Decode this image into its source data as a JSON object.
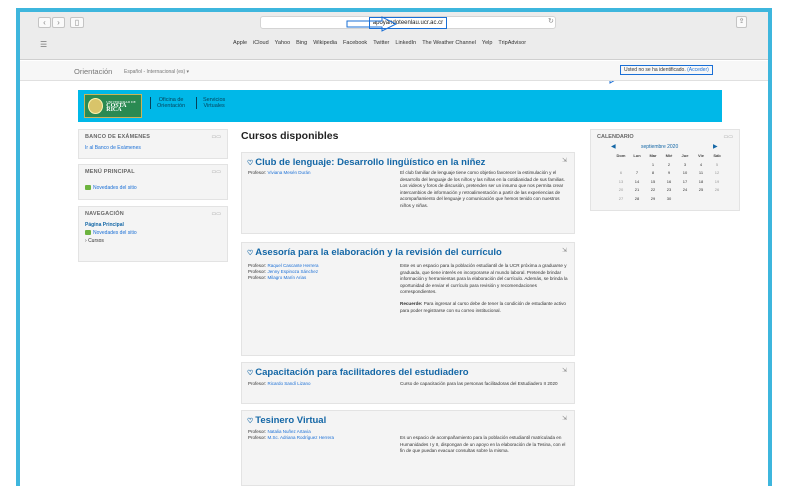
{
  "browser": {
    "url": "apoyandoteenlau.ucr.ac.cr",
    "bookmarks": [
      "Apple",
      "iCloud",
      "Yahoo",
      "Bing",
      "Wikipedia",
      "Facebook",
      "Twitter",
      "LinkedIn",
      "The Weather Channel",
      "Yelp",
      "TripAdvisor"
    ]
  },
  "header": {
    "site_name": "Orientación",
    "language": "Español - Internacional (es) ▾",
    "login_text": "Usted no se ha identificado.",
    "login_link": "(Acceder)"
  },
  "banner": {
    "logo_small": "UNIVERSIDAD DE",
    "logo_big": "COSTA RICA",
    "link1_line1": "Oficina de",
    "link1_line2": "Orientación",
    "link2_line1": "Servicios",
    "link2_line2": "Virtuales"
  },
  "left": {
    "banco": {
      "title": "BANCO DE EXÁMENES",
      "link": "Ir al Banco de Exámenes"
    },
    "menu": {
      "title": "MENÚ PRINCIPAL",
      "item": "Novedades del sitio"
    },
    "nav": {
      "title": "NAVEGACIÓN",
      "home": "Página Principal",
      "news": "Novedades del sitio",
      "courses": "Cursos"
    }
  },
  "main": {
    "title": "Cursos disponibles",
    "courses": [
      {
        "title": "Club de lenguaje: Desarrollo lingüístico en la niñez",
        "teachers": [
          {
            "role": "Profesor:",
            "name": "Viviana Mesén Durán"
          }
        ],
        "summary": "El club familiar de lenguaje tiene como objetivo favorecer la estimulación y el desarrollo del lenguaje de los niños y las niñas en la cotidianidad de sus familias. Los videos y foros de discusión, pretenden ser un insumo que nos permita crear intercambios de información y retroalimentación a partir de las experiencias de acompañamiento del lenguaje y comunicación que hemos tenido con nuestros niños y niñas."
      },
      {
        "title": "Asesoría para la elaboración y la revisión del currículo",
        "teachers": [
          {
            "role": "Profesor:",
            "name": "Raquel Cascante Herrera"
          },
          {
            "role": "Profesor:",
            "name": "Jenny Espinoza Sánchez"
          },
          {
            "role": "Profesor:",
            "name": "Milagro Marín Arias"
          }
        ],
        "summary": "Este es un espacio  para la población estudiantil de la UCR próxima a graduarse y graduada,  que tiene interés en incorporarse al mundo laboral. Pretende brindar información y herramientas para la elaboración del currículo. Además, se brinda la oportunidad de enviar el currículo para revisión y recomendaciones correspondientes.",
        "note_label": "Recuerde:",
        "note": " Para ingresar al curso debe de tener la condición de estudiante activo para poder registrarse con su correo institucional."
      },
      {
        "title": "Capacitación para facilitadores del estudiadero",
        "teachers": [
          {
            "role": "Profesor:",
            "name": "Ricardo Sandí Lizano"
          }
        ],
        "summary": "Curso de capacitación para las personas facilitadoras del Estudiadero II 2020"
      },
      {
        "title": "Tesinero Virtual",
        "teachers": [
          {
            "role": "Profesor:",
            "name": "Natalia Nuñez Artavia"
          },
          {
            "role": "Profesor:",
            "name": "M.Sc. Adriana Rodríguez Herrera"
          }
        ],
        "summary": "Es un espacio de acompañamiento para la población estudiantil matriculada en Humanidades I y II, dispongan de un apoyo en la elaboración de la Tesina, con el fin de que puedan evacuar consultas sobre la misma."
      }
    ]
  },
  "calendar": {
    "title": "CALENDARIO",
    "month": "septiembre 2020",
    "days": [
      "Dom",
      "Lun",
      "Mar",
      "Mié",
      "Jue",
      "Vie",
      "Sáb"
    ],
    "cells": [
      "",
      "",
      "1",
      "2",
      "3",
      "4",
      "5",
      "6",
      "7",
      "8",
      "9",
      "10",
      "11",
      "12",
      "13",
      "14",
      "15",
      "16",
      "17",
      "18",
      "19",
      "20",
      "21",
      "22",
      "23",
      "24",
      "25",
      "26",
      "27",
      "28",
      "29",
      "30",
      "",
      "",
      ""
    ]
  }
}
